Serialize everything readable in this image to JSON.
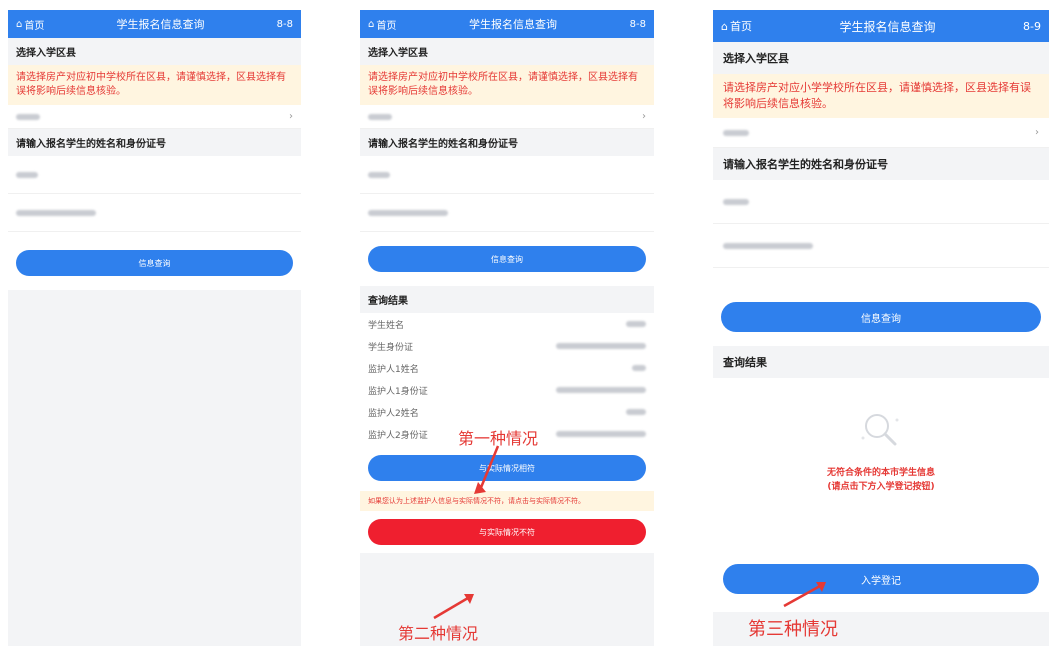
{
  "common": {
    "home_label": "首页",
    "app_title": "学生报名信息查询",
    "select_district_title": "选择入学区县",
    "name_id_title": "请输入报名学生的姓名和身份证号",
    "query_button": "信息查询",
    "chevron": "›"
  },
  "phone1": {
    "version": "8-8",
    "warning": "请选择房产对应初中学校所在区县，请谨慎选择，区县选择有误将影响后续信息核验。"
  },
  "phone2": {
    "version": "8-8",
    "warning": "请选择房产对应初中学校所在区县，请谨慎选择，区县选择有误将影响后续信息核验。",
    "result_title": "查询结果",
    "result_rows": [
      {
        "label": "学生姓名"
      },
      {
        "label": "学生身份证"
      },
      {
        "label": "监护人1姓名"
      },
      {
        "label": "监护人1身份证"
      },
      {
        "label": "监护人2姓名"
      },
      {
        "label": "监护人2身份证"
      }
    ],
    "match_button": "与实际情况相符",
    "note": "如果您认为上述监护人信息与实际情况不符，请点击与实际情况不符。",
    "mismatch_button": "与实际情况不符",
    "annotation_1": "第一种情况",
    "annotation_2": "第二种情况"
  },
  "phone3": {
    "version": "8-9",
    "warning": "请选择房产对应小学学校所在区县，请谨慎选择，区县选择有误将影响后续信息核验。",
    "result_title": "查询结果",
    "empty_line1": "无符合条件的本市学生信息",
    "empty_line2": "(请点击下方入学登记按钮)",
    "register_button": "入学登记",
    "annotation_3": "第三种情况"
  },
  "colors": {
    "primary": "#2f80ed",
    "danger": "#ef1f2f",
    "warning_bg": "#fff5e0"
  }
}
